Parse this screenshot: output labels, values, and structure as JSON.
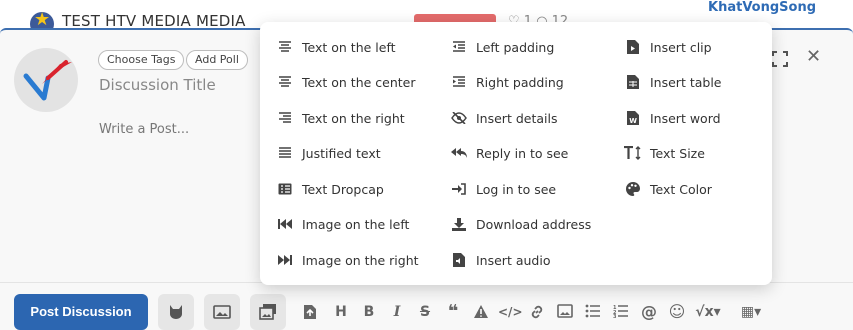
{
  "background": {
    "post_title": "TEST HTV MEDIA MEDIA",
    "post_meta": "♡ 1   ○ 12",
    "sidebar_user": "KhatVongSong"
  },
  "composer": {
    "choose_tags_label": "Choose Tags",
    "add_poll_label": "Add Poll",
    "title_placeholder": "Discussion Title",
    "post_placeholder": "Write a Post...",
    "post_button_label": "Post Discussion"
  },
  "menu": {
    "col1": [
      "Text on the left",
      "Text on the center",
      "Text on the right",
      "Justified text",
      "Text Dropcap",
      "Image on the left",
      "Image on the right"
    ],
    "col2": [
      "Left padding",
      "Right padding",
      "Insert details",
      "Reply in to see",
      "Log in to see",
      "Download address",
      "Insert audio"
    ],
    "col3": [
      "Insert clip",
      "Insert table",
      "Insert word",
      "Text Size",
      "Text Color"
    ]
  },
  "colors": {
    "accent": "#2c66b1",
    "border_accent": "#3d6fb0",
    "sidebar_link": "#2e6bb5"
  }
}
